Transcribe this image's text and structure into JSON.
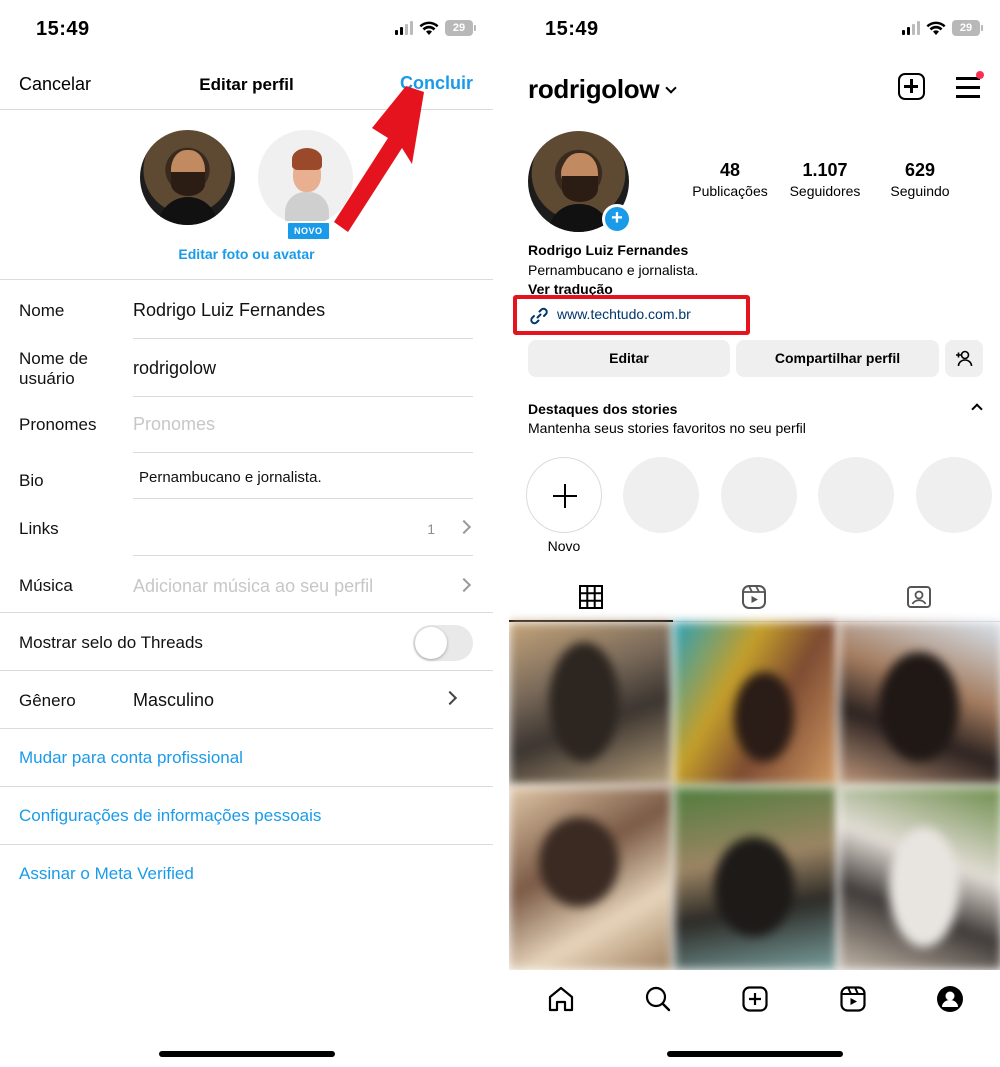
{
  "left_screen": {
    "status": {
      "time": "15:49",
      "battery": "29"
    },
    "topbar": {
      "cancel": "Cancelar",
      "title": "Editar perfil",
      "done": "Concluir"
    },
    "photo": {
      "badge": "NOVO",
      "edit_link": "Editar foto ou avatar"
    },
    "fields": {
      "name": {
        "label": "Nome",
        "value": "Rodrigo Luiz Fernandes"
      },
      "username": {
        "label": "Nome de usuário",
        "value": "rodrigolow"
      },
      "pronouns": {
        "label": "Pronomes",
        "placeholder": "Pronomes"
      },
      "bio": {
        "label": "Bio",
        "value": "Pernambucano e jornalista."
      },
      "links": {
        "label": "Links",
        "count": "1"
      },
      "music": {
        "label": "Música",
        "placeholder": "Adicionar música ao seu perfil"
      },
      "threads": {
        "label": "Mostrar selo do Threads",
        "enabled": false
      },
      "gender": {
        "label": "Gênero",
        "value": "Masculino"
      }
    },
    "links": {
      "professional": "Mudar para conta profissional",
      "personal_info": "Configurações de informações pessoais",
      "meta_verified": "Assinar o Meta Verified"
    }
  },
  "right_screen": {
    "status": {
      "time": "15:49",
      "battery": "29"
    },
    "username": "rodrigolow",
    "stats": [
      {
        "number": "48",
        "label": "Publicações"
      },
      {
        "number": "1.107",
        "label": "Seguidores"
      },
      {
        "number": "629",
        "label": "Seguindo"
      }
    ],
    "bio": {
      "name": "Rodrigo Luiz Fernandes",
      "text": "Pernambucano e jornalista.",
      "translate": "Ver tradução",
      "url": "www.techtudo.com.br"
    },
    "buttons": {
      "edit": "Editar",
      "share": "Compartilhar perfil"
    },
    "highlights": {
      "title": "Destaques dos stories",
      "subtitle": "Mantenha seus stories favoritos no seu perfil",
      "new_label": "Novo"
    }
  },
  "colors": {
    "accent": "#1a9bea",
    "link_url": "#00376b",
    "annotation_red": "#e5131d",
    "notification": "#ff2e55"
  },
  "icons": [
    "signal-icon",
    "wifi-icon",
    "battery-icon",
    "chevron-right-icon",
    "chevron-down-icon",
    "add-post-icon",
    "menu-icon",
    "link-icon",
    "add-person-icon",
    "grid-icon",
    "reels-icon",
    "tagged-icon",
    "home-icon",
    "search-icon",
    "create-icon",
    "profile-icon"
  ]
}
